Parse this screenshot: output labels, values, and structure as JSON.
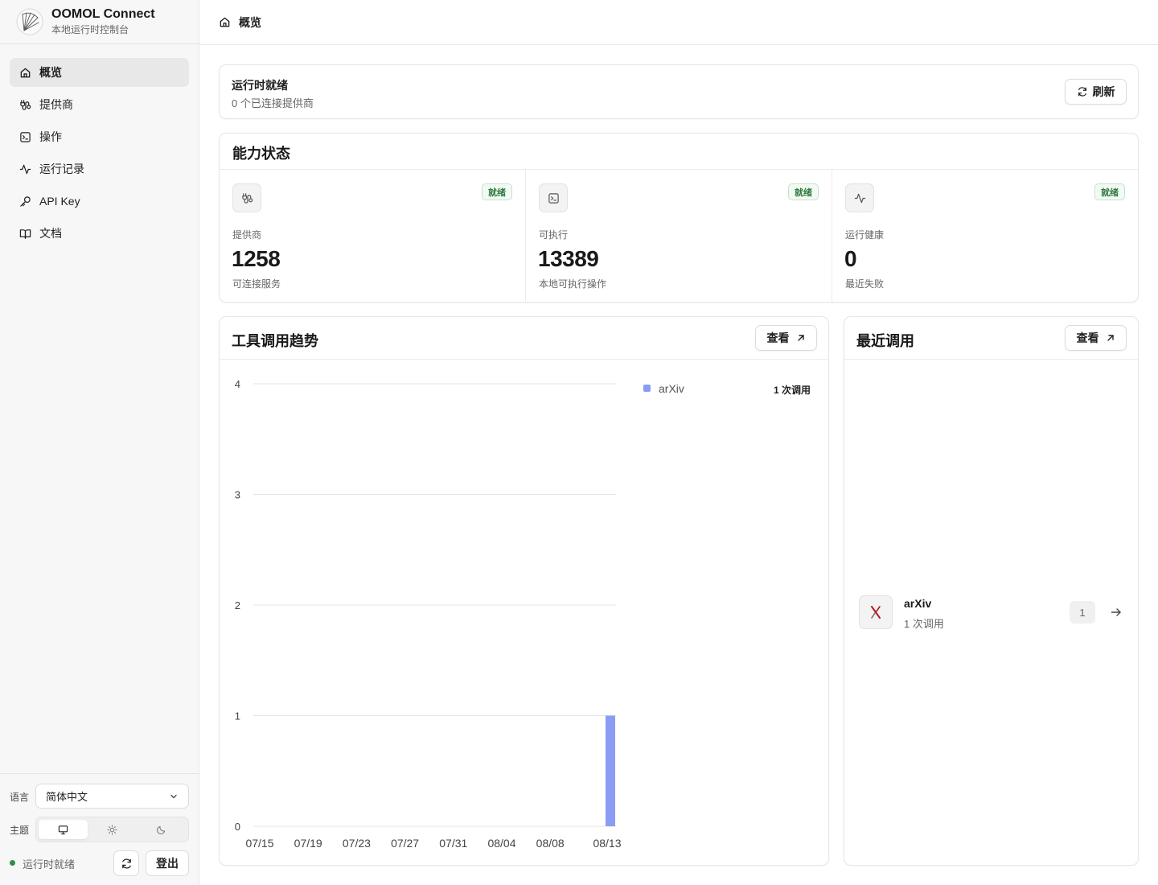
{
  "app": {
    "title": "OOMOL Connect",
    "subtitle": "本地运行时控制台"
  },
  "nav": {
    "items": [
      {
        "label": "概览",
        "icon": "home-icon",
        "active": true
      },
      {
        "label": "提供商",
        "icon": "plug-icon"
      },
      {
        "label": "操作",
        "icon": "terminal-icon"
      },
      {
        "label": "运行记录",
        "icon": "activity-icon"
      },
      {
        "label": "API Key",
        "icon": "key-icon"
      },
      {
        "label": "文档",
        "icon": "book-icon"
      }
    ]
  },
  "settings": {
    "language_label": "语言",
    "language_value": "简体中文",
    "theme_label": "主题",
    "theme_options": [
      "system",
      "light",
      "dark"
    ],
    "theme_selected": "system"
  },
  "footer": {
    "status": "运行时就绪",
    "status_color": "#2f8f46",
    "logout_label": "登出"
  },
  "breadcrumb": {
    "label": "概览"
  },
  "runtime": {
    "title": "运行时就绪",
    "subtitle": "0 个已连接提供商",
    "refresh_label": "刷新"
  },
  "capabilities": {
    "title": "能力状态",
    "items": [
      {
        "label": "提供商",
        "value": "1258",
        "desc": "可连接服务",
        "badge": "就绪",
        "icon": "plug-icon"
      },
      {
        "label": "可执行",
        "value": "13389",
        "desc": "本地可执行操作",
        "badge": "就绪",
        "icon": "terminal-icon"
      },
      {
        "label": "运行健康",
        "value": "0",
        "desc": "最近失败",
        "badge": "就绪",
        "icon": "activity-icon"
      }
    ]
  },
  "trend": {
    "title": "工具调用趋势",
    "view_label": "查看"
  },
  "recent": {
    "title": "最近调用",
    "view_label": "查看",
    "items": [
      {
        "name": "arXiv",
        "sub": "1 次调用",
        "count": "1"
      }
    ]
  },
  "chart_data": {
    "type": "bar",
    "title": "",
    "xlabel": "",
    "ylabel": "",
    "ylim": [
      0,
      4
    ],
    "y_ticks": [
      0,
      1,
      2,
      3,
      4
    ],
    "x_tick_labels": [
      "07/15",
      "07/19",
      "07/23",
      "07/27",
      "07/31",
      "08/04",
      "08/08",
      "08/13"
    ],
    "categories": [
      "08/13"
    ],
    "series": [
      {
        "name": "arXiv",
        "values": [
          1
        ],
        "color": "#8b9cf4",
        "legend_value": "1 次调用"
      }
    ],
    "grid": true,
    "legend": "top-right"
  }
}
